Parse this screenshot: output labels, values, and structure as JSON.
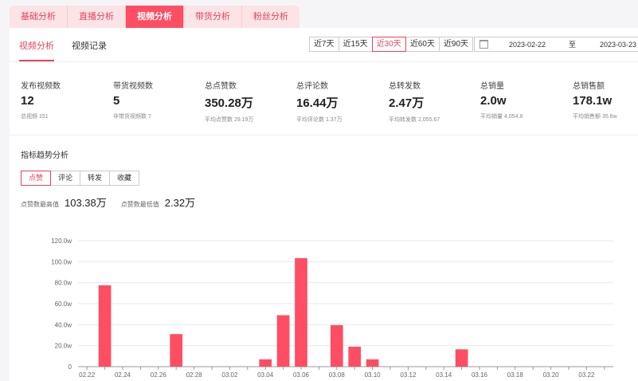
{
  "main_tabs": [
    "基础分析",
    "直播分析",
    "视频分析",
    "带货分析",
    "粉丝分析"
  ],
  "main_tab_active": 2,
  "sub_tabs": [
    "视频分析",
    "视频记录"
  ],
  "ranges": [
    "近7天",
    "近15天",
    "近30天",
    "近60天",
    "近90天"
  ],
  "range_active": 2,
  "date": {
    "start": "2023-02-22",
    "to": "至",
    "end": "2023-03-23"
  },
  "stats": [
    {
      "label": "发布视频数",
      "value": "12",
      "sub": "总视频 151"
    },
    {
      "label": "带货视频数",
      "value": "5",
      "sub": "非带货视频数 7"
    },
    {
      "label": "总点赞数",
      "value": "350.28万",
      "sub": "平均点赞数 29.19万"
    },
    {
      "label": "总评论数",
      "value": "16.44万",
      "sub": "平均评论数 1.37万"
    },
    {
      "label": "总转发数",
      "value": "2.47万",
      "sub": "平均转发数 2,055.67"
    },
    {
      "label": "总销量",
      "value": "2.0w",
      "sub": "平均销量 4,054.8"
    },
    {
      "label": "总销售额",
      "value": "178.1w",
      "sub": "平均销售额 35.6w"
    }
  ],
  "section_title": "指标趋势分析",
  "metric_tabs": [
    "点赞",
    "评论",
    "转发",
    "收藏"
  ],
  "metric_active": 0,
  "maxmin": {
    "max_label": "点赞数最高值",
    "max_value": "103.38万",
    "min_label": "点赞数最低值",
    "min_value": "2.32万"
  },
  "colors": {
    "accent": "#ff4d63",
    "bar": "#ff4d63"
  },
  "chart_data": {
    "type": "bar",
    "categories": [
      "02.22",
      "02.23",
      "02.24",
      "02.25",
      "02.26",
      "02.27",
      "02.28",
      "03.01",
      "03.02",
      "03.03",
      "03.04",
      "03.05",
      "03.06",
      "03.07",
      "03.08",
      "03.09",
      "03.10",
      "03.11",
      "03.12",
      "03.13",
      "03.14",
      "03.15",
      "03.16",
      "03.17",
      "03.18",
      "03.19",
      "03.20",
      "03.21",
      "03.22",
      "03.23"
    ],
    "tick_labels": [
      "02.22",
      "02.24",
      "02.26",
      "02.28",
      "03.02",
      "03.04",
      "03.06",
      "03.08",
      "03.10",
      "03.12",
      "03.14",
      "03.16",
      "03.18",
      "03.20",
      "03.22"
    ],
    "values": [
      0,
      77.5,
      0,
      0,
      0,
      31,
      0,
      0,
      0,
      0,
      7,
      49,
      103.38,
      0,
      39.5,
      19,
      7,
      0,
      0,
      0,
      0,
      16.5,
      0,
      0,
      0,
      0,
      0,
      0,
      0,
      0
    ],
    "yticks": [
      "0",
      "20.0w",
      "40.0w",
      "60.0w",
      "80.0w",
      "100.0w",
      "120.0w"
    ],
    "ylim": [
      0,
      120
    ]
  }
}
